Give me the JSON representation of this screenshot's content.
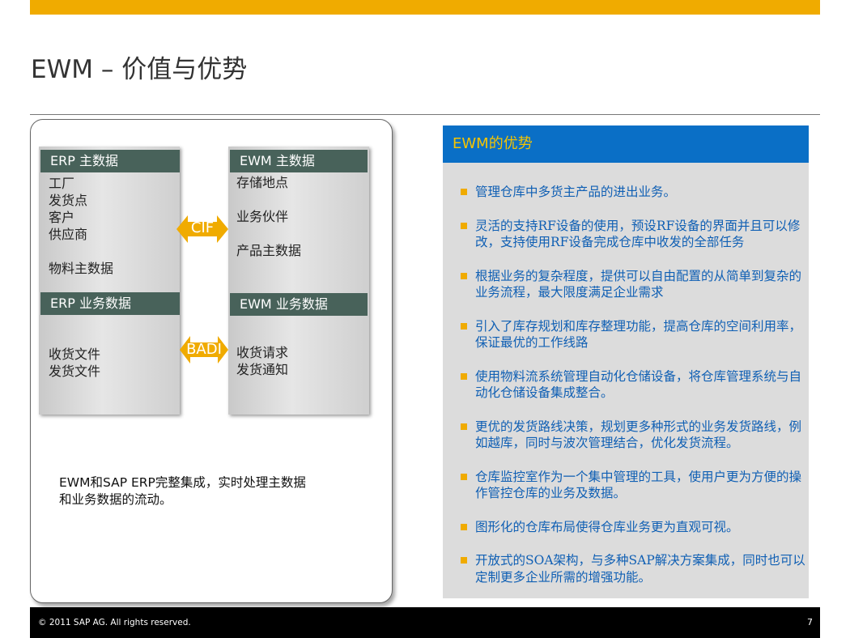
{
  "slide": {
    "title": "EWM – 价值与优势",
    "footer_copyright": "© 2011 SAP AG. All rights reserved.",
    "page_number": "7"
  },
  "diagram": {
    "erp_master_header": "ERP 主数据",
    "erp_master_items": "工厂\n发货点\n客户\n供应商\n\n物料主数据",
    "erp_business_header": "ERP 业务数据",
    "erp_business_items": "收货文件\n发货文件",
    "ewm_master_header": "EWM 主数据",
    "ewm_master_items": "存储地点\n\n业务伙伴\n\n产品主数据",
    "ewm_business_header": "EWM 业务数据",
    "ewm_business_items": "收货请求\n发货通知",
    "arrow_top_label": "CIF",
    "arrow_bottom_label": "BADI",
    "caption_line1": "EWM和SAP ERP完整集成，实时处理主数据",
    "caption_line2": "和业务数据的流动。"
  },
  "advantages": {
    "header": "EWM的优势",
    "items": [
      "管理仓库中多货主产品的进出业务。",
      "灵活的支持RF设备的使用，预设RF设备的界面并且可以修改，支持使用RF设备完成仓库中收发的全部任务",
      "根据业务的复杂程度，提供可以自由配置的从简单到复杂的业务流程，最大限度满足企业需求",
      "引入了库存规划和库存整理功能，提高仓库的空间利用率，保证最优的工作线路",
      "使用物料流系统管理自动化仓储设备，将仓库管理系统与自动化仓储设备集成整合。",
      "更优的发货路线决策，规划更多种形式的业务发货路线，例如越库，同时与波次管理结合，优化发货流程。",
      "仓库监控室作为一个集中管理的工具，使用户更为方便的操作管控仓库的业务及数据。",
      "图形化的仓库布局使得仓库业务更为直观可视。",
      "开放式的SOA架构，与多种SAP解决方案集成，同时也可以定制更多企业所需的增强功能。"
    ]
  },
  "colors": {
    "accent_yellow": "#f0ab00",
    "header_blue": "#0a6fc6",
    "header_green": "#48625a",
    "bullet_text": "#0f5fb4"
  }
}
